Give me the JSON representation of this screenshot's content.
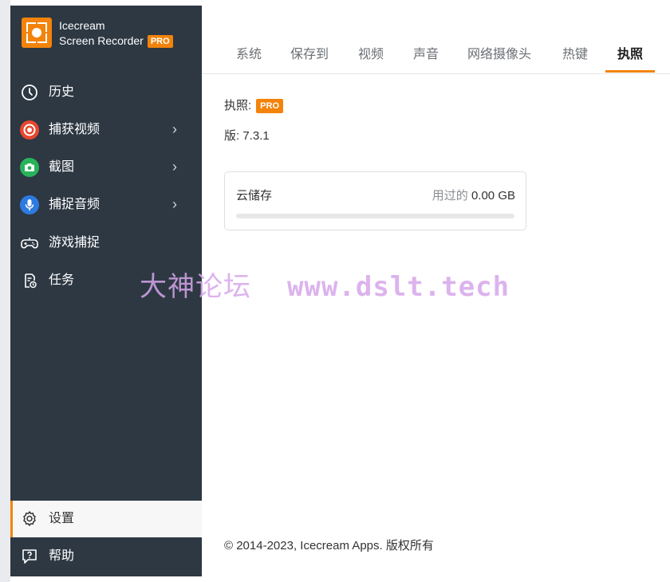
{
  "app": {
    "name_line1": "Icecream",
    "name_line2": "Screen Recorder",
    "badge": "PRO",
    "brand_color": "#f3830b"
  },
  "sidebar": {
    "items": [
      {
        "label": "历史",
        "icon": "clock-icon"
      },
      {
        "label": "捕获视频",
        "icon": "record-icon",
        "has_submenu": true
      },
      {
        "label": "截图",
        "icon": "camera-icon",
        "has_submenu": true
      },
      {
        "label": "捕捉音频",
        "icon": "microphone-icon",
        "has_submenu": true
      },
      {
        "label": "游戏捕捉",
        "icon": "gamepad-icon"
      },
      {
        "label": "任务",
        "icon": "task-icon"
      }
    ],
    "settings_label": "设置",
    "help_label": "帮助",
    "chevron": "›"
  },
  "tabs": [
    {
      "label": "系统"
    },
    {
      "label": "保存到"
    },
    {
      "label": "视频"
    },
    {
      "label": "声音"
    },
    {
      "label": "网络摄像头"
    },
    {
      "label": "热键"
    },
    {
      "label": "执照",
      "active": true
    }
  ],
  "license": {
    "label": "执照:",
    "badge": "PRO",
    "version_label": "版:",
    "version": "7.3.1"
  },
  "cloud": {
    "title": "云储存",
    "used_label": "用过的",
    "used_value": "0.00 GB",
    "progress_fraction": 0
  },
  "footer": "© 2014-2023, Icecream Apps. 版权所有",
  "watermark": {
    "text": "大神论坛",
    "url": "www.dslt.tech"
  }
}
